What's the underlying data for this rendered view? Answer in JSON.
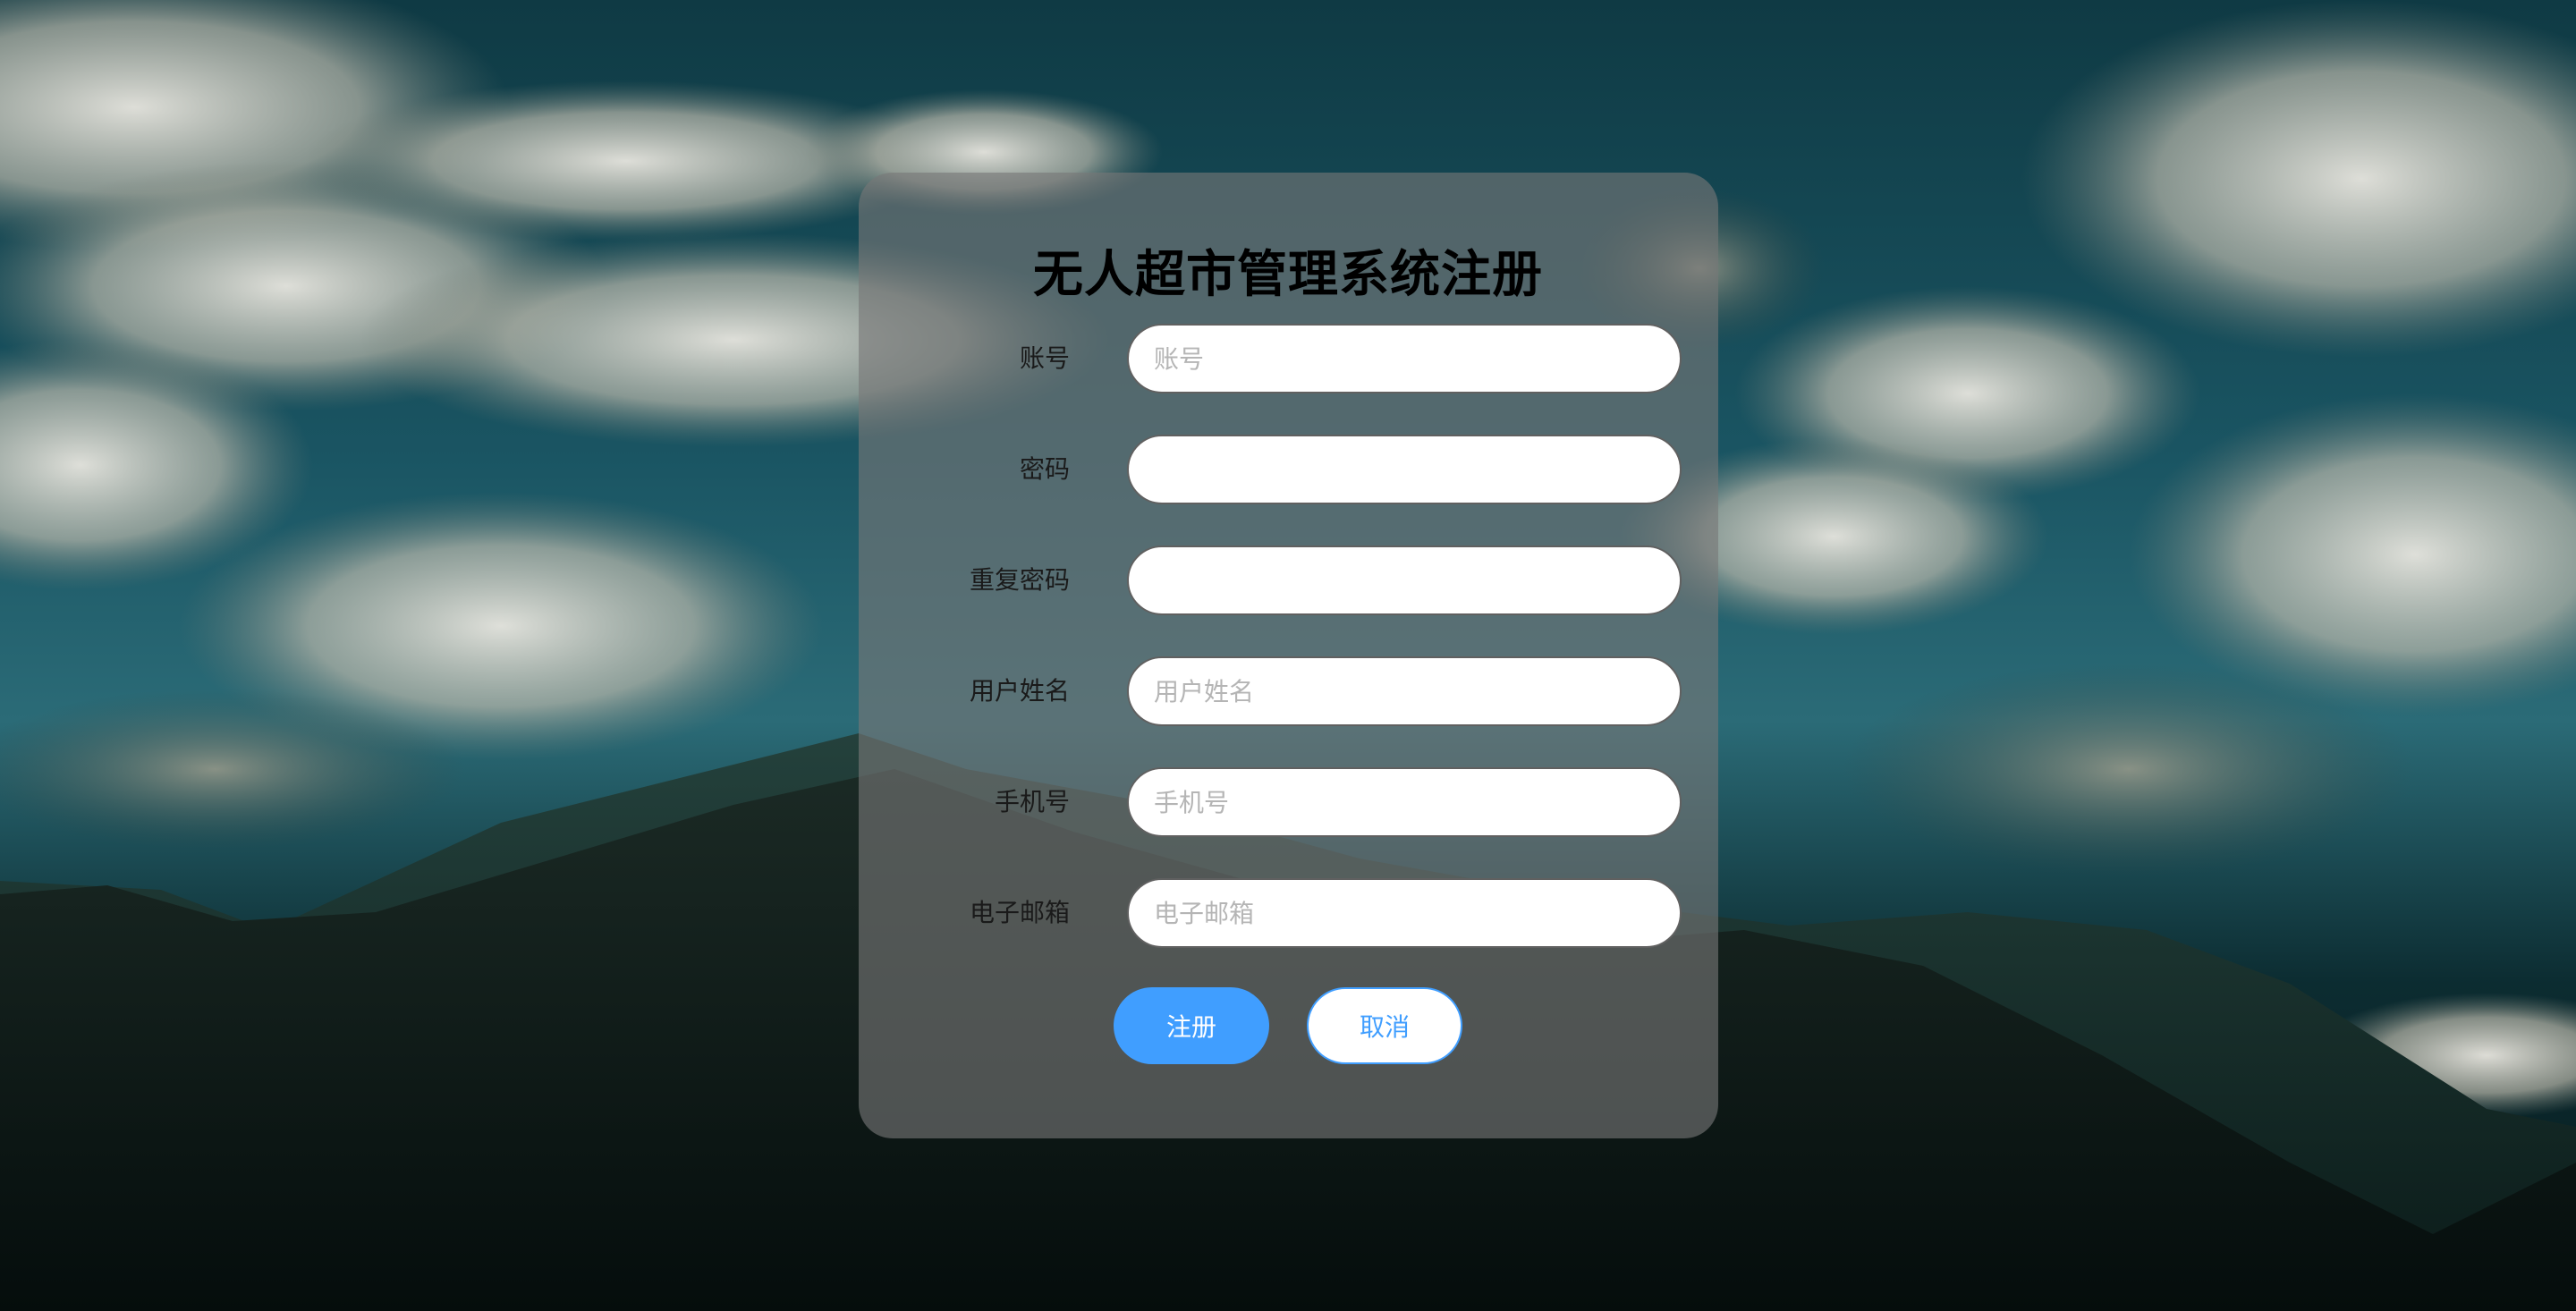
{
  "page": {
    "title": "无人超市管理系统注册"
  },
  "form": {
    "fields": [
      {
        "label": "账号",
        "placeholder": "账号",
        "value": ""
      },
      {
        "label": "密码",
        "placeholder": "",
        "value": ""
      },
      {
        "label": "重复密码",
        "placeholder": "",
        "value": ""
      },
      {
        "label": "用户姓名",
        "placeholder": "用户姓名",
        "value": ""
      },
      {
        "label": "手机号",
        "placeholder": "手机号",
        "value": ""
      },
      {
        "label": "电子邮箱",
        "placeholder": "电子邮箱",
        "value": ""
      }
    ]
  },
  "actions": {
    "register_label": "注册",
    "cancel_label": "取消"
  },
  "colors": {
    "primary": "#409eff",
    "card_background": "rgba(120,120,120,0.62)",
    "field_background": "#ffffff"
  }
}
